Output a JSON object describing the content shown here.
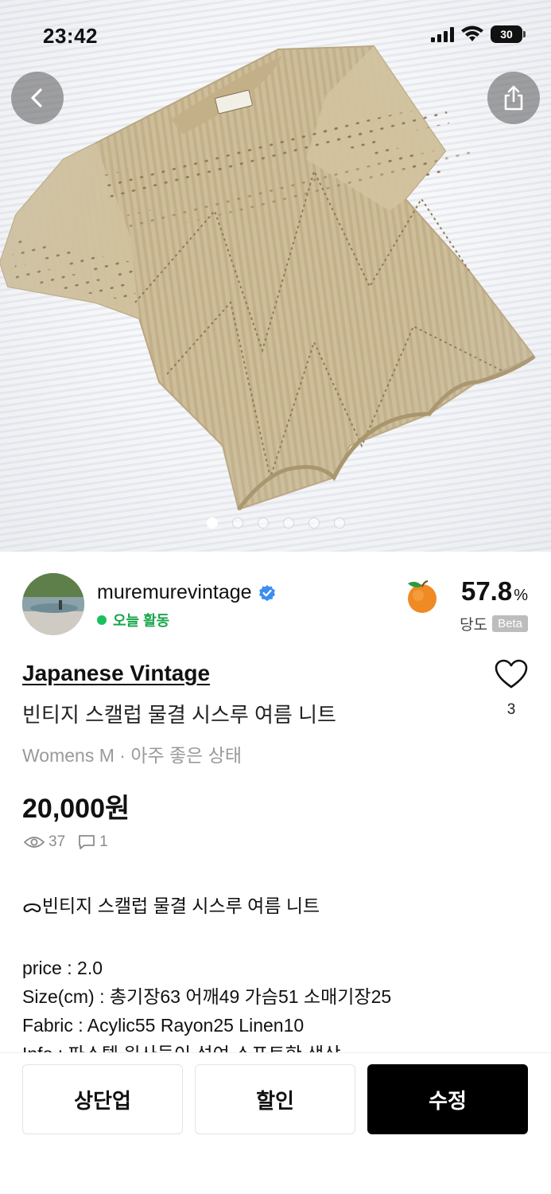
{
  "status_bar": {
    "time": "23:42",
    "battery": "30"
  },
  "nav": {
    "back_icon": "chevron-left-icon",
    "share_icon": "share-icon"
  },
  "carousel": {
    "count": 6,
    "active_index": 0
  },
  "seller": {
    "name": "muremurevintage",
    "verified": true,
    "activity": "오늘 활동",
    "sweetness_value": "57.8",
    "sweetness_unit": "%",
    "sweetness_label": "당도",
    "beta_label": "Beta"
  },
  "product": {
    "brand": "Japanese Vintage",
    "title": "빈티지 스캘럽 물결 시스루 여름 니트",
    "condition": "Womens M · 아주 좋은 상태",
    "likes": "3",
    "price": "20,000원",
    "views": "37",
    "comments": "1"
  },
  "description": {
    "heading": "ᯅ빈티지 스캘럽 물결 시스루 여름 니트",
    "lines": [
      "price : 2.0",
      "Size(cm) : 총기장63 어깨49 가슴51 소매기장25",
      "Fabric : Acylic55 Rayon25 Linen10",
      "Info : 파스텔 원사들이 섞여 소프트한 색상"
    ]
  },
  "actions": {
    "bump": "상단업",
    "discount": "할인",
    "edit": "수정"
  },
  "colors": {
    "accent_green": "#19c15a",
    "dark_button": "#000000"
  }
}
